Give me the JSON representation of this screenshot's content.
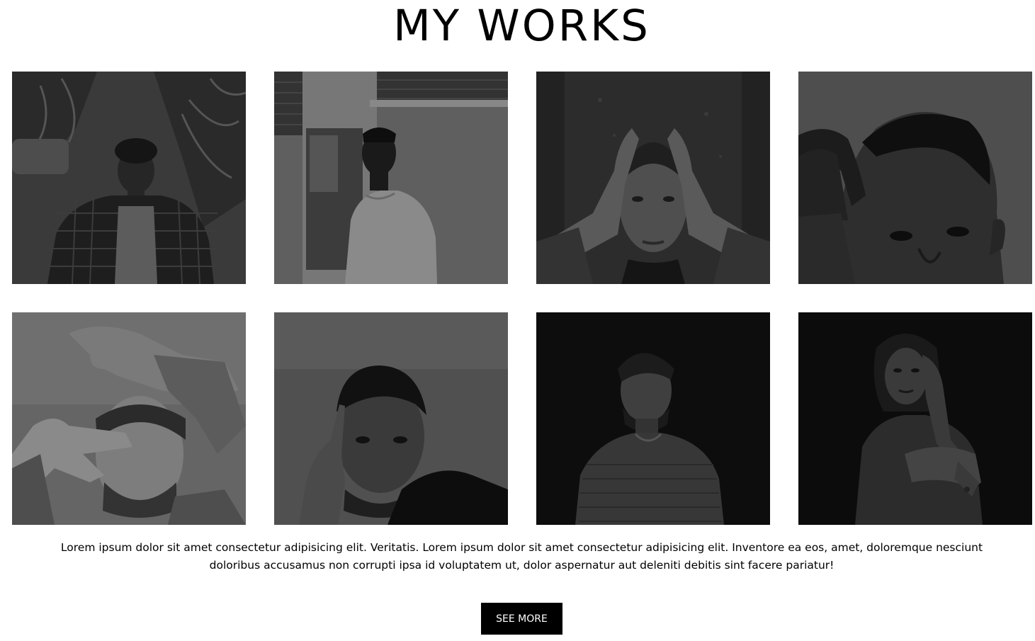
{
  "section": {
    "title": "MY WORKS",
    "description": "Lorem ipsum dolor sit amet consectetur adipisicing elit. Veritatis. Lorem ipsum dolor sit amet consectetur adipisicing elit. Inventore ea eos, amet, doloremque nesciunt doloribus accusamus non corrupti ipsa id voluptatem ut, dolor aspernatur aut deleniti debitis sint facere pariatur!",
    "button_label": "SEE MORE"
  },
  "colors": {
    "background": "#ffffff",
    "text": "#000000",
    "button_background": "#000000",
    "button_text": "#ffffff"
  },
  "gallery": {
    "photos": [
      {
        "subject": "man-plaid-shirt-palms",
        "tone": "#3a3a3a"
      },
      {
        "subject": "man-tshirt-brick-wall",
        "tone": "#5a5a5a"
      },
      {
        "subject": "woman-hands-on-head",
        "tone": "#2a2a2a"
      },
      {
        "subject": "man-hand-on-forehead-closeup",
        "tone": "#4a4a4a"
      },
      {
        "subject": "man-hands-over-eyes",
        "tone": "#6a6a6a"
      },
      {
        "subject": "man-finger-on-temple",
        "tone": "#474747"
      },
      {
        "subject": "man-knit-sweater-dark",
        "tone": "#0d0d0d"
      },
      {
        "subject": "woman-arms-crossed-dark",
        "tone": "#0d0d0d"
      }
    ]
  }
}
